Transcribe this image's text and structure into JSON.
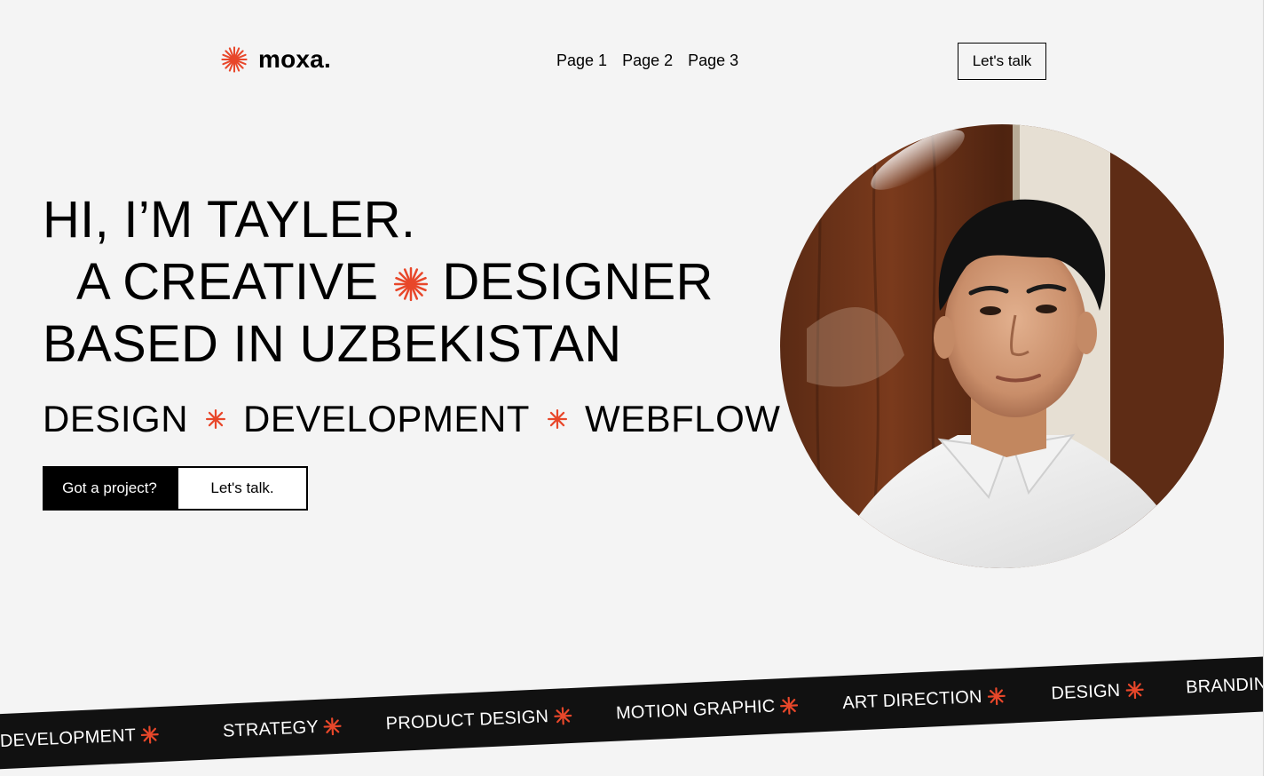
{
  "brand": {
    "name": "moxa.",
    "accent_color": "#e8472a",
    "logo_icon": "starburst-icon"
  },
  "nav": {
    "items": [
      {
        "label": "Page 1"
      },
      {
        "label": "Page 2"
      },
      {
        "label": "Page 3"
      }
    ],
    "talk_button": "Let's talk"
  },
  "hero": {
    "line1": "HI, I’M TAYLER.",
    "line2_a": "A CREATIVE",
    "line2_b": "DESIGNER",
    "line3": "BASED IN UZBEKISTAN",
    "services": [
      "DESIGN",
      "DEVELOPMENT",
      "WEBFLOW"
    ],
    "cta_primary": "Got a project?",
    "cta_secondary": "Let's talk."
  },
  "portrait": {
    "icon": "portrait-photo"
  },
  "ticker": {
    "background": "#111111",
    "items": [
      "DEVELOPMENT",
      "STRATEGY",
      "PRODUCT DESIGN",
      "MOTION GRAPHIC",
      "ART DIRECTION",
      "DESIGN",
      "BRANDING"
    ]
  }
}
